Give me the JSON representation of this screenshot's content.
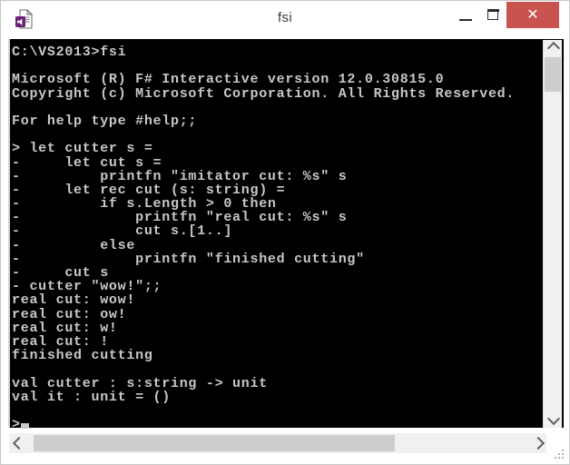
{
  "window": {
    "title": "fsi",
    "icon": "fsharp-script-document-icon",
    "controls": {
      "minimize": "–",
      "maximize": "□",
      "close": "✕",
      "close_color": "#c9534f"
    }
  },
  "console": {
    "background_color": "#000000",
    "text_color": "#c8c8c8",
    "lines": [
      "C:\\VS2013>fsi",
      "",
      "Microsoft (R) F# Interactive version 12.0.30815.0",
      "Copyright (c) Microsoft Corporation. All Rights Reserved.",
      "",
      "For help type #help;;",
      "",
      "> let cutter s =",
      "-     let cut s =",
      "-         printfn \"imitator cut: %s\" s",
      "-     let rec cut (s: string) =",
      "-         if s.Length > 0 then",
      "-             printfn \"real cut: %s\" s",
      "-             cut s.[1..]",
      "-         else",
      "-             printfn \"finished cutting\"",
      "-     cut s",
      "- cutter \"wow!\";;",
      "real cut: wow!",
      "real cut: ow!",
      "real cut: w!",
      "real cut: !",
      "finished cutting",
      "",
      "val cutter : s:string -> unit",
      "val it : unit = ()",
      "",
      ">"
    ],
    "prompt": ">",
    "continuation_prompt": "-"
  },
  "scrollbars": {
    "vertical": {
      "up_arrow": "scroll-up-arrow",
      "down_arrow": "scroll-down-arrow",
      "thumb": "vertical-scroll-thumb"
    },
    "horizontal": {
      "left_arrow": "scroll-left-arrow",
      "right_arrow": "scroll-right-arrow",
      "thumb": "horizontal-scroll-thumb"
    }
  },
  "resize_grip": "resize-grip"
}
